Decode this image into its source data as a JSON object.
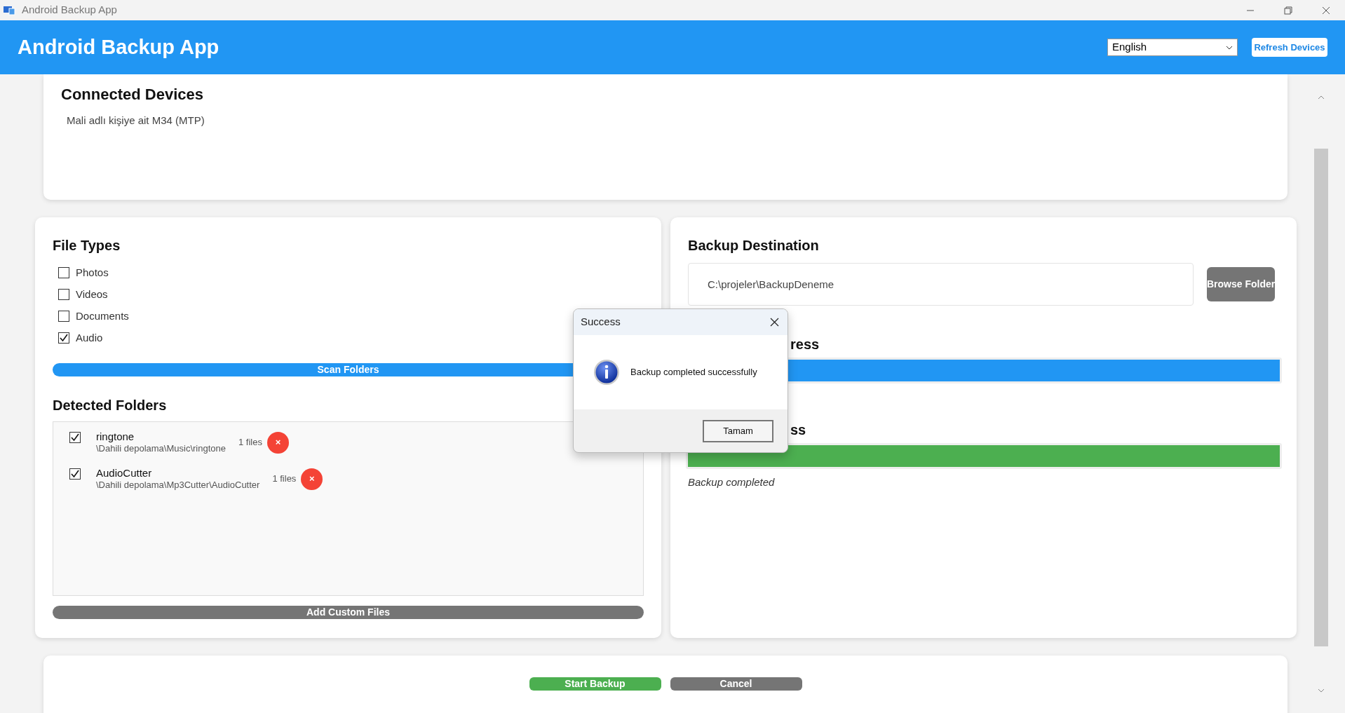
{
  "window": {
    "title": "Android Backup App"
  },
  "header": {
    "title": "Android Backup App",
    "language": {
      "value": "English"
    },
    "refresh_button": "Refresh Devices"
  },
  "connected_devices": {
    "title": "Connected Devices",
    "devices": [
      "Mali adlı kişiye ait M34 (MTP)"
    ]
  },
  "file_types": {
    "title": "File Types",
    "items": [
      {
        "label": "Photos",
        "checked": false
      },
      {
        "label": "Videos",
        "checked": false
      },
      {
        "label": "Documents",
        "checked": false
      },
      {
        "label": "Audio",
        "checked": true
      }
    ],
    "scan_button": "Scan Folders"
  },
  "detected_folders": {
    "title": "Detected Folders",
    "folders": [
      {
        "name": "ringtone",
        "path": "\\Dahili depolama\\Music\\ringtone",
        "count": "1 files",
        "checked": true
      },
      {
        "name": "AudioCutter",
        "path": "\\Dahili depolama\\Mp3Cutter\\AudioCutter",
        "count": "1 files",
        "checked": true
      }
    ],
    "add_button": "Add Custom Files",
    "remove_glyph": "×"
  },
  "destination": {
    "title": "Backup Destination",
    "path": "C:\\projeler\\BackupDeneme",
    "browse_button": "Browse Folder"
  },
  "scan_progress": {
    "title": "ress",
    "level": 1
  },
  "backup_progress": {
    "title": "ss",
    "level": 1,
    "status": "Backup completed"
  },
  "actions": [
    {
      "kind": "start",
      "label": "Start Backup"
    },
    {
      "kind": "cancel",
      "label": "Cancel"
    }
  ],
  "dialog": {
    "title": "Success",
    "message": "Backup completed successfully",
    "button": "Tamam"
  }
}
